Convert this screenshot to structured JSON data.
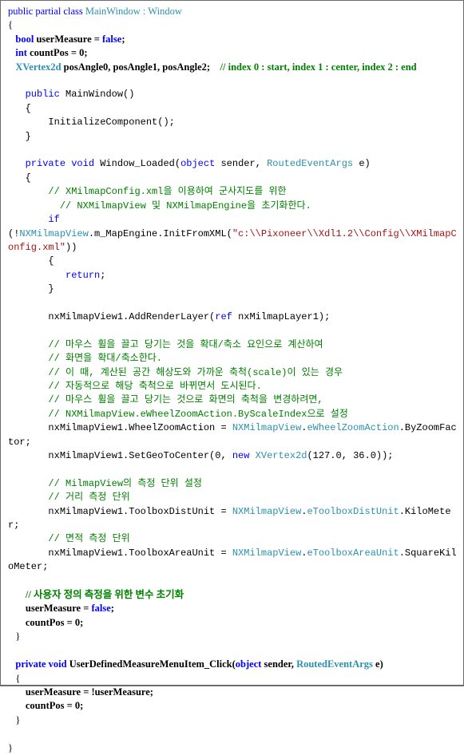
{
  "colors": {
    "keyword": "#0000ff",
    "type": "#2b91af",
    "comment": "#008000",
    "string": "#a31515",
    "text": "#000000",
    "border": "#6b6b6b"
  },
  "lines": [
    {
      "cls": "",
      "tokens": [
        [
          "kw",
          "public partial class "
        ],
        [
          "ty",
          "MainWindow"
        ],
        [
          "",
          ""
        ],
        [
          "ty",
          " : Window"
        ]
      ]
    },
    {
      "cls": "",
      "tokens": [
        [
          "",
          "{"
        ]
      ]
    },
    {
      "cls": "bold",
      "tokens": [
        [
          "",
          "   "
        ],
        [
          "kw",
          "bool"
        ],
        [
          "",
          " userMeasure = "
        ],
        [
          "kw",
          "false"
        ],
        [
          "",
          ";"
        ]
      ]
    },
    {
      "cls": "bold",
      "tokens": [
        [
          "",
          "   "
        ],
        [
          "kw",
          "int"
        ],
        [
          "",
          " countPos = 0;"
        ]
      ]
    },
    {
      "cls": "bold",
      "tokens": [
        [
          "",
          "   "
        ],
        [
          "ty",
          "XVertex2d"
        ],
        [
          "",
          " posAngle0, posAngle1, posAngle2;    "
        ],
        [
          "cm",
          "// index 0 : start, index 1 : center, index 2 : end"
        ]
      ]
    },
    {
      "cls": "",
      "tokens": [
        [
          "",
          ""
        ]
      ]
    },
    {
      "cls": "mono",
      "tokens": [
        [
          "",
          "   "
        ],
        [
          "kw",
          "public"
        ],
        [
          "",
          " MainWindow()"
        ]
      ]
    },
    {
      "cls": "mono",
      "tokens": [
        [
          "",
          "   {"
        ]
      ]
    },
    {
      "cls": "mono",
      "tokens": [
        [
          "",
          "       InitializeComponent();"
        ]
      ]
    },
    {
      "cls": "mono",
      "tokens": [
        [
          "",
          "   }"
        ]
      ]
    },
    {
      "cls": "",
      "tokens": [
        [
          "",
          ""
        ]
      ]
    },
    {
      "cls": "mono",
      "tokens": [
        [
          "",
          "   "
        ],
        [
          "kw",
          "private void"
        ],
        [
          "",
          " Window_Loaded("
        ],
        [
          "kw",
          "object"
        ],
        [
          "",
          " sender, "
        ],
        [
          "ty",
          "RoutedEventArgs"
        ],
        [
          "",
          " e)"
        ]
      ]
    },
    {
      "cls": "mono",
      "tokens": [
        [
          "",
          "   {"
        ]
      ]
    },
    {
      "cls": "mono",
      "tokens": [
        [
          "",
          "       "
        ],
        [
          "cm",
          "// XMilmapConfig.xml을 이용하여 군사지도를 위한"
        ]
      ]
    },
    {
      "cls": "mono",
      "tokens": [
        [
          "",
          "         "
        ],
        [
          "cm",
          "// NXMilmapView 및 NXMilmapEngine을 초기화한다."
        ]
      ]
    },
    {
      "cls": "mono",
      "tokens": [
        [
          "",
          "       "
        ],
        [
          "kw",
          "if"
        ]
      ]
    },
    {
      "cls": "mono",
      "tokens": [
        [
          "",
          "(!"
        ],
        [
          "ty",
          "NXMilmapView"
        ],
        [
          "",
          ".m_MapEngine.InitFromXML("
        ],
        [
          "st",
          "\"c:\\\\Pixoneer\\\\Xdl1.2\\\\Config\\\\XMilmapConfig.xml\""
        ],
        [
          "",
          "))"
        ]
      ]
    },
    {
      "cls": "mono",
      "tokens": [
        [
          "",
          "       {"
        ]
      ]
    },
    {
      "cls": "mono",
      "tokens": [
        [
          "",
          "          "
        ],
        [
          "kw",
          "return"
        ],
        [
          "",
          ";"
        ]
      ]
    },
    {
      "cls": "mono",
      "tokens": [
        [
          "",
          "       }"
        ]
      ]
    },
    {
      "cls": "",
      "tokens": [
        [
          "",
          ""
        ]
      ]
    },
    {
      "cls": "mono",
      "tokens": [
        [
          "",
          "       nxMilmapView1.AddRenderLayer("
        ],
        [
          "kw",
          "ref"
        ],
        [
          "",
          " nxMilmapLayer1);"
        ]
      ]
    },
    {
      "cls": "",
      "tokens": [
        [
          "",
          ""
        ]
      ]
    },
    {
      "cls": "mono",
      "tokens": [
        [
          "",
          "       "
        ],
        [
          "cm",
          "// 마우스 휠을 끌고 당기는 것을 확대/축소 요인으로 계산하여"
        ]
      ]
    },
    {
      "cls": "mono",
      "tokens": [
        [
          "",
          "       "
        ],
        [
          "cm",
          "// 화면을 확대/축소한다."
        ]
      ]
    },
    {
      "cls": "mono",
      "tokens": [
        [
          "",
          "       "
        ],
        [
          "cm",
          "// 이 때, 계산된 공간 해상도와 가까운 축척(scale)이 있는 경우"
        ]
      ]
    },
    {
      "cls": "mono",
      "tokens": [
        [
          "",
          "       "
        ],
        [
          "cm",
          "// 자동적으로 해당 축척으로 바뀌면서 도시된다."
        ]
      ]
    },
    {
      "cls": "mono",
      "tokens": [
        [
          "",
          "       "
        ],
        [
          "cm",
          "// 마우스 휠을 끌고 당기는 것으로 화면의 축척을 변경하려면,"
        ]
      ]
    },
    {
      "cls": "mono",
      "tokens": [
        [
          "",
          "       "
        ],
        [
          "cm",
          "// NXMilmapView.eWheelZoomAction.ByScaleIndex으로 설정"
        ]
      ]
    },
    {
      "cls": "mono",
      "tokens": [
        [
          "",
          "       nxMilmapView1.WheelZoomAction = "
        ],
        [
          "ty",
          "NXMilmapView"
        ],
        [
          "",
          "."
        ],
        [
          "ty",
          "eWheelZoomAction"
        ],
        [
          "",
          ".ByZoomFactor;"
        ]
      ]
    },
    {
      "cls": "mono",
      "tokens": [
        [
          "",
          "       nxMilmapView1.SetGeoToCenter(0, "
        ],
        [
          "kw",
          "new"
        ],
        [
          "",
          " "
        ],
        [
          "ty",
          "XVertex2d"
        ],
        [
          "",
          "(127.0, 36.0));"
        ]
      ]
    },
    {
      "cls": "",
      "tokens": [
        [
          "",
          ""
        ]
      ]
    },
    {
      "cls": "mono",
      "tokens": [
        [
          "",
          "       "
        ],
        [
          "cm",
          "// MilmapView의 측정 단위 설정"
        ]
      ]
    },
    {
      "cls": "mono",
      "tokens": [
        [
          "",
          "       "
        ],
        [
          "cm",
          "// 거리 측정 단위"
        ]
      ]
    },
    {
      "cls": "mono",
      "tokens": [
        [
          "",
          "       nxMilmapView1.ToolboxDistUnit = "
        ],
        [
          "ty",
          "NXMilmapView"
        ],
        [
          "",
          "."
        ],
        [
          "ty",
          "eToolboxDistUnit"
        ],
        [
          "",
          ".KiloMeter;"
        ]
      ]
    },
    {
      "cls": "mono",
      "tokens": [
        [
          "",
          "       "
        ],
        [
          "cm",
          "// 면적 측정 단위"
        ]
      ]
    },
    {
      "cls": "mono",
      "tokens": [
        [
          "",
          "       nxMilmapView1.ToolboxAreaUnit = "
        ],
        [
          "ty",
          "NXMilmapView"
        ],
        [
          "",
          "."
        ],
        [
          "ty",
          "eToolboxAreaUnit"
        ],
        [
          "",
          ".SquareKiloMeter;"
        ]
      ]
    },
    {
      "cls": "",
      "tokens": [
        [
          "",
          ""
        ]
      ]
    },
    {
      "cls": "bold",
      "tokens": [
        [
          "",
          "       "
        ],
        [
          "cm",
          "// 사용자 정의 측정을 위한 변수 초기화"
        ]
      ]
    },
    {
      "cls": "bold",
      "tokens": [
        [
          "",
          "       userMeasure = "
        ],
        [
          "kw",
          "false"
        ],
        [
          "",
          ";"
        ]
      ]
    },
    {
      "cls": "bold",
      "tokens": [
        [
          "",
          "       countPos = 0;"
        ]
      ]
    },
    {
      "cls": "",
      "tokens": [
        [
          "",
          "   }"
        ]
      ]
    },
    {
      "cls": "",
      "tokens": [
        [
          "",
          ""
        ]
      ]
    },
    {
      "cls": "bold",
      "tokens": [
        [
          "",
          "   "
        ],
        [
          "kw",
          "private void"
        ],
        [
          "",
          " UserDefinedMeasureMenuItem_Click("
        ],
        [
          "kw",
          "object"
        ],
        [
          "",
          " sender, "
        ],
        [
          "ty",
          "RoutedEventArgs"
        ],
        [
          "",
          " e)"
        ]
      ]
    },
    {
      "cls": "",
      "tokens": [
        [
          "",
          "   {"
        ]
      ]
    },
    {
      "cls": "bold",
      "tokens": [
        [
          "",
          "       userMeasure = !userMeasure;"
        ]
      ]
    },
    {
      "cls": "bold",
      "tokens": [
        [
          "",
          "       countPos = 0;"
        ]
      ]
    },
    {
      "cls": "",
      "tokens": [
        [
          "",
          "   }"
        ]
      ]
    },
    {
      "cls": "",
      "tokens": [
        [
          "",
          ""
        ]
      ]
    },
    {
      "cls": "",
      "tokens": [
        [
          "",
          "}"
        ]
      ]
    }
  ]
}
